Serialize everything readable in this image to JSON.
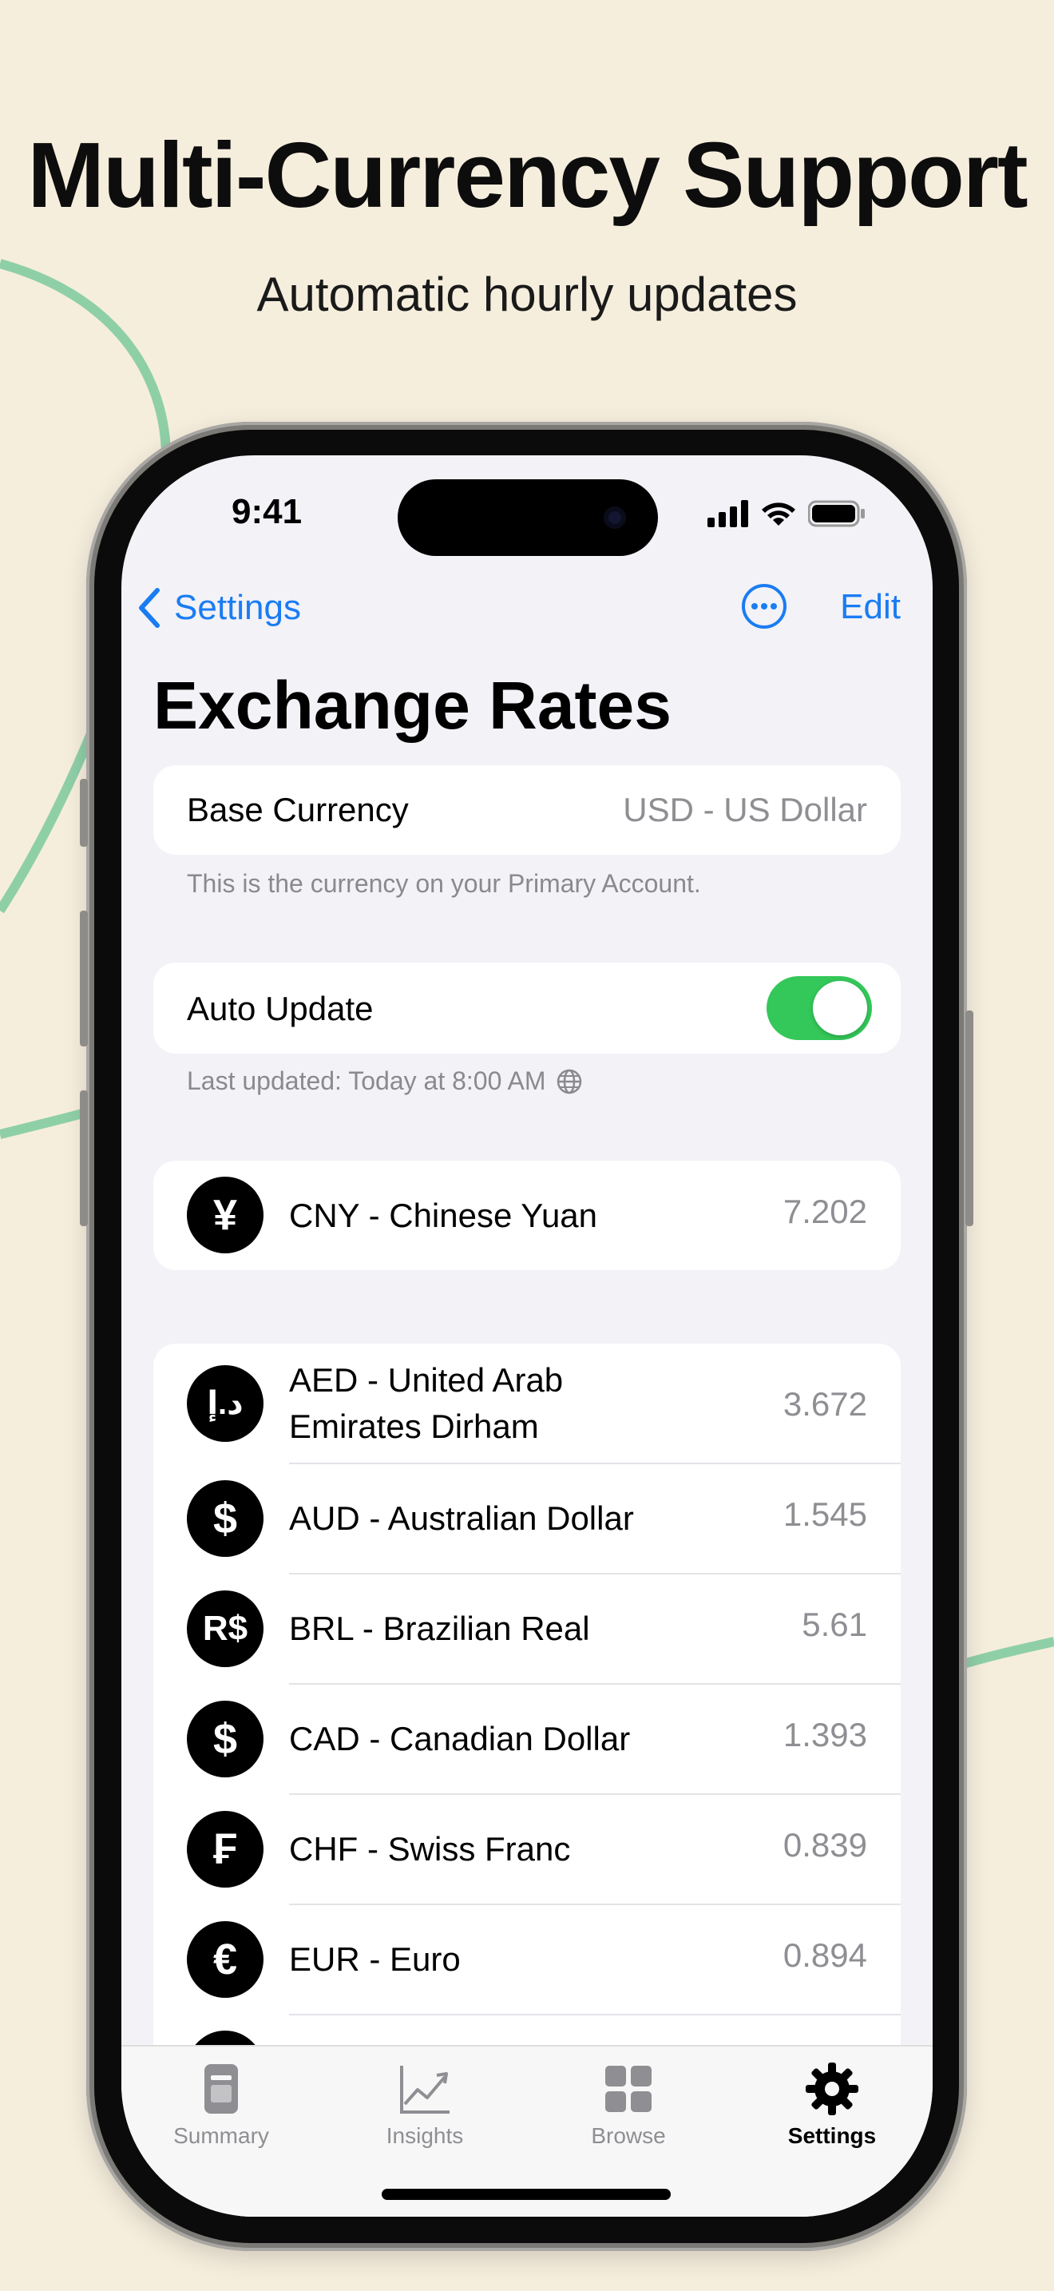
{
  "promo": {
    "headline": "Multi-Currency Support",
    "subhead": "Automatic hourly updates"
  },
  "colors": {
    "background": "#f6eedd",
    "accent": "#1a7cf2",
    "toggle_on": "#34c759",
    "decor_line": "#8fcfa8"
  },
  "status_bar": {
    "time": "9:41"
  },
  "nav": {
    "back_label": "Settings",
    "edit_label": "Edit",
    "more_icon": "ellipsis-circle-icon"
  },
  "page": {
    "title": "Exchange Rates"
  },
  "base_currency": {
    "label": "Base Currency",
    "value": "USD - US Dollar",
    "footnote": "This is the currency on your Primary Account."
  },
  "auto_update": {
    "label": "Auto Update",
    "enabled": true,
    "footnote": "Last updated: Today at 8:00 AM"
  },
  "pinned_currency": {
    "symbol": "¥",
    "name": "CNY - Chinese Yuan",
    "rate": "7.202"
  },
  "currencies": [
    {
      "symbol": "د.إ",
      "name": "AED - United Arab Emirates Dirham",
      "rate": "3.672"
    },
    {
      "symbol": "$",
      "name": "AUD - Australian Dollar",
      "rate": "1.545"
    },
    {
      "symbol": "R$",
      "name": "BRL - Brazilian Real",
      "rate": "5.61"
    },
    {
      "symbol": "$",
      "name": "CAD - Canadian Dollar",
      "rate": "1.393"
    },
    {
      "symbol": "₣",
      "name": "CHF - Swiss Franc",
      "rate": "0.839"
    },
    {
      "symbol": "€",
      "name": "EUR - Euro",
      "rate": "0.894"
    }
  ],
  "tabs": [
    {
      "label": "Summary",
      "icon": "summary-icon",
      "active": false
    },
    {
      "label": "Insights",
      "icon": "chart-line-icon",
      "active": false
    },
    {
      "label": "Browse",
      "icon": "grid-icon",
      "active": false
    },
    {
      "label": "Settings",
      "icon": "gear-icon",
      "active": true
    }
  ]
}
